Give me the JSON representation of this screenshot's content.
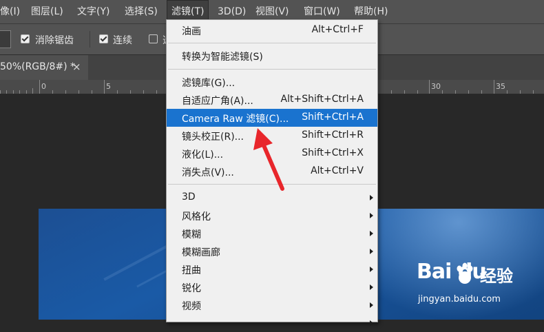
{
  "menubar": {
    "items": [
      "像(I)",
      "图层(L)",
      "文字(Y)",
      "选择(S)",
      "滤镜(T)",
      "3D(D)",
      "视图(V)",
      "窗口(W)",
      "帮助(H)"
    ],
    "active_index": 4
  },
  "options": {
    "antialias_label": "消除锯齿",
    "antialias_checked": true,
    "contiguous_label": "连续",
    "contiguous_checked": true,
    "sample_all_label": "选",
    "sample_all_checked": false
  },
  "document_tab": {
    "title": "50%(RGB/8#) *",
    "close_glyph": "×"
  },
  "ruler": {
    "labels": [
      "0",
      "5",
      "30",
      "35"
    ]
  },
  "filter_menu": {
    "group1": [
      {
        "label": "油画",
        "shortcut": "Alt+Ctrl+F"
      }
    ],
    "group2": [
      {
        "label": "转换为智能滤镜(S)",
        "shortcut": ""
      }
    ],
    "group3": [
      {
        "label": "滤镜库(G)...",
        "shortcut": ""
      },
      {
        "label": "自适应广角(A)...",
        "shortcut": "Alt+Shift+Ctrl+A"
      },
      {
        "label": "Camera Raw 滤镜(C)...",
        "shortcut": "Shift+Ctrl+A"
      },
      {
        "label": "镜头校正(R)...",
        "shortcut": "Shift+Ctrl+R"
      },
      {
        "label": "液化(L)...",
        "shortcut": "Shift+Ctrl+X"
      },
      {
        "label": "消失点(V)...",
        "shortcut": "Alt+Ctrl+V"
      }
    ],
    "group4": [
      {
        "label": "3D"
      },
      {
        "label": "风格化"
      },
      {
        "label": "模糊"
      },
      {
        "label": "模糊画廊"
      },
      {
        "label": "扭曲"
      },
      {
        "label": "锐化"
      },
      {
        "label": "视频"
      }
    ],
    "highlighted": "Camera Raw 滤镜(C)...",
    "highlight_color": "#1a73cf"
  },
  "watermark": {
    "brand": "Bai du",
    "brand_cn": "经验",
    "url": "jingyan.baidu.com"
  },
  "annotation": {
    "arrow_color": "#e8262b"
  }
}
